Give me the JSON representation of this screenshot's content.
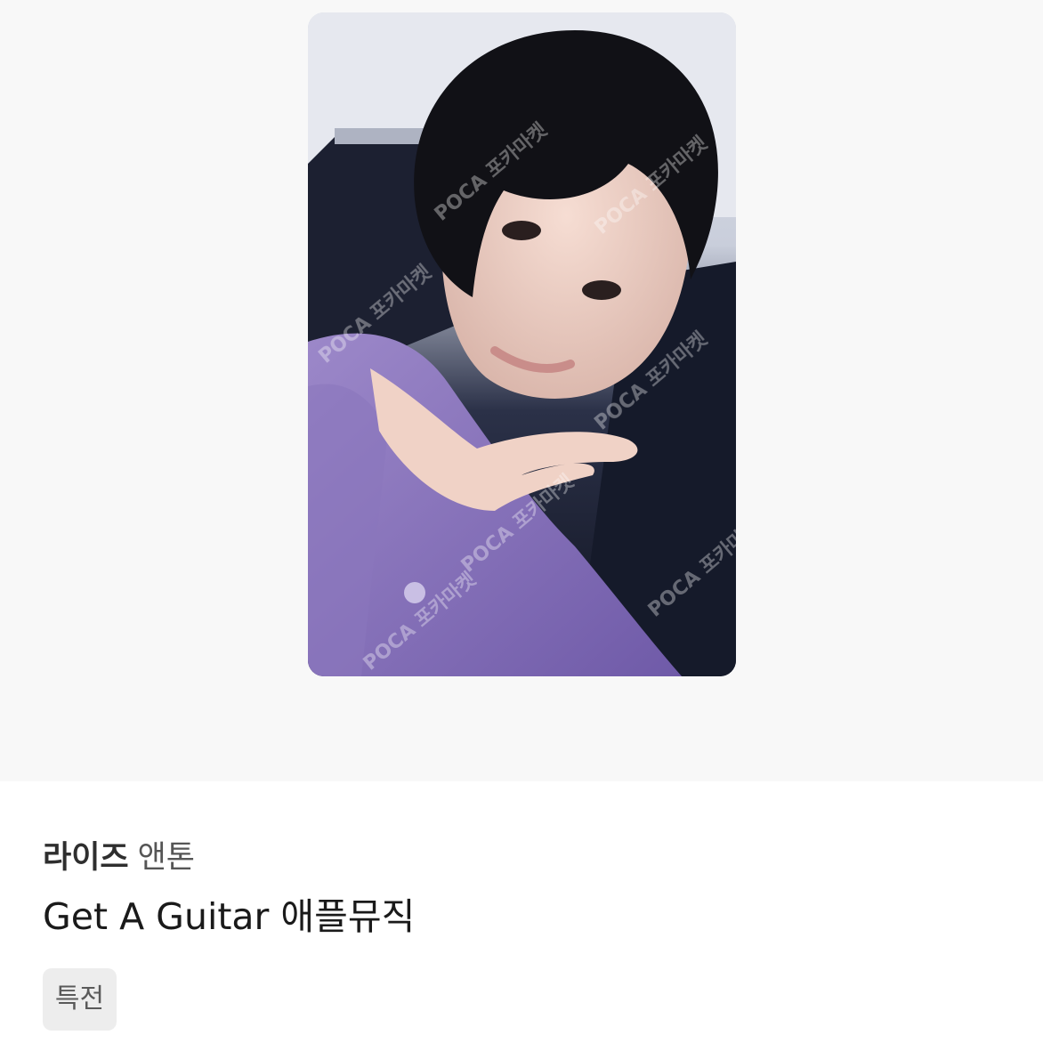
{
  "product": {
    "image": {
      "icon": "photocard-selfie-image",
      "watermark": "POCA 포카마켓"
    },
    "artist": "라이즈",
    "member": "앤톤",
    "title": "Get A Guitar 애플뮤직",
    "tag": "특전"
  }
}
